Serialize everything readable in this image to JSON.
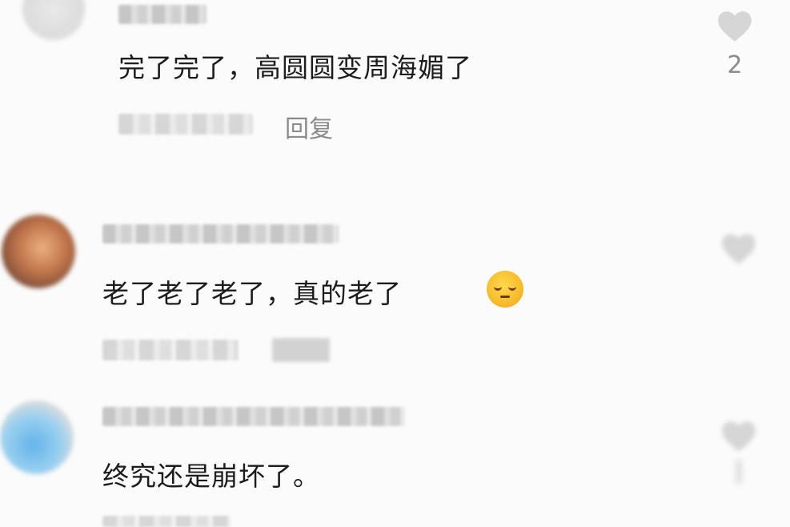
{
  "comments": [
    {
      "text": "完了完了，高圆圆变周海媚了",
      "reply_label": "回复",
      "like_count": "2"
    },
    {
      "text": "老了老了老了，真的老了",
      "emoji": "pensive-face"
    },
    {
      "text": "终究还是崩坏了。"
    }
  ],
  "colors": {
    "background": "#fbfbfb",
    "heart": "#d6d6d6",
    "muted_text": "#8a8a8a"
  }
}
